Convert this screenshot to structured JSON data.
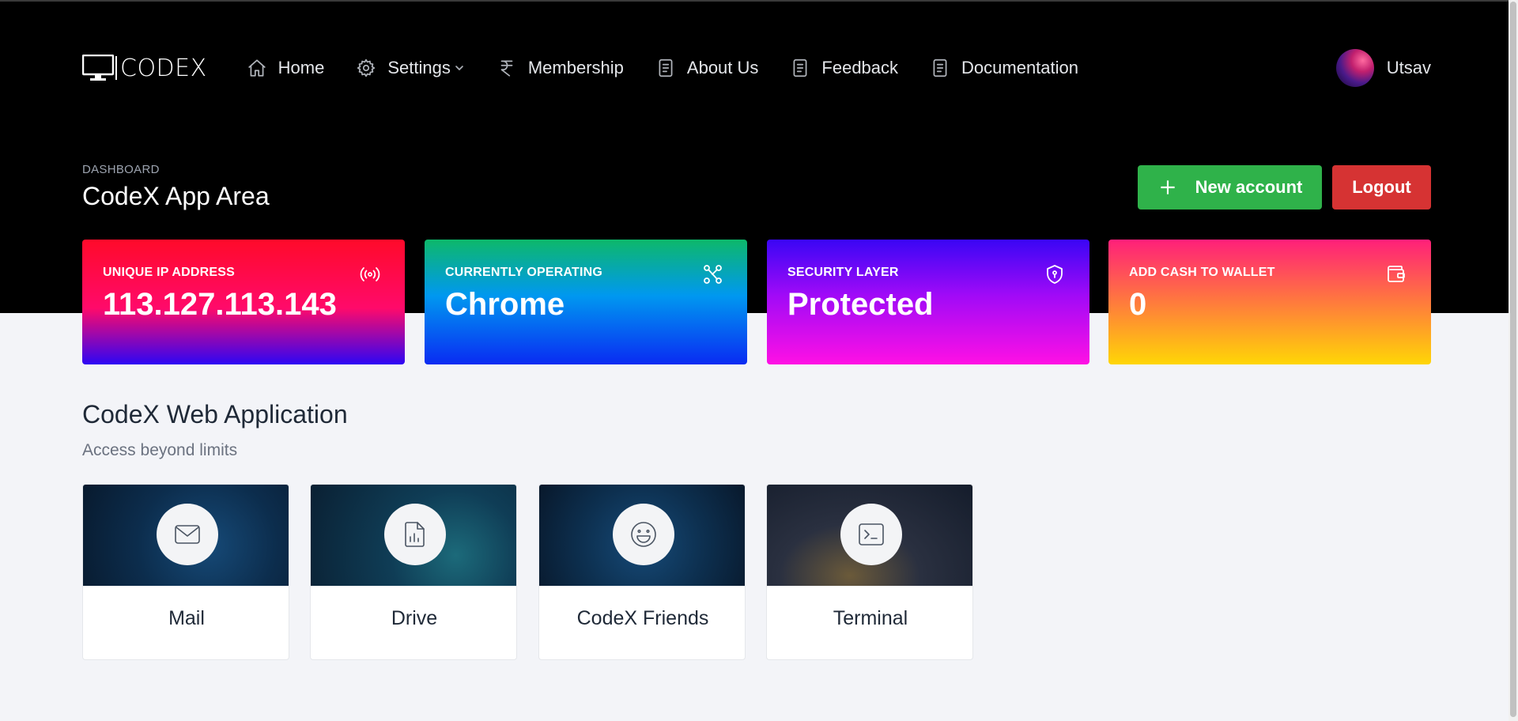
{
  "brand": {
    "name": "CODEX"
  },
  "nav": {
    "items": [
      {
        "label": "Home",
        "icon": "home-icon"
      },
      {
        "label": "Settings",
        "icon": "gear-icon"
      },
      {
        "label": "Membership",
        "icon": "rupee-icon"
      },
      {
        "label": "About Us",
        "icon": "document-icon"
      },
      {
        "label": "Feedback",
        "icon": "document-icon"
      },
      {
        "label": "Documentation",
        "icon": "document-icon"
      }
    ]
  },
  "user": {
    "name": "Utsav"
  },
  "page": {
    "breadcrumb": "DASHBOARD",
    "title": "CodeX App Area",
    "new_account_label": "New account",
    "logout_label": "Logout"
  },
  "stats": [
    {
      "label": "UNIQUE IP ADDRESS",
      "value": "113.127.113.143",
      "icon": "broadcast-icon"
    },
    {
      "label": "CURRENTLY OPERATING",
      "value": "Chrome",
      "icon": "network-icon"
    },
    {
      "label": "SECURITY LAYER",
      "value": "Protected",
      "icon": "shield-icon"
    },
    {
      "label": "ADD CASH TO WALLET",
      "value": "0",
      "icon": "wallet-icon"
    }
  ],
  "section": {
    "title": "CodeX Web Application",
    "subtitle": "Access beyond limits"
  },
  "apps": [
    {
      "name": "Mail",
      "icon": "mail-icon"
    },
    {
      "name": "Drive",
      "icon": "file-chart-icon"
    },
    {
      "name": "CodeX Friends",
      "icon": "smile-icon"
    },
    {
      "name": "Terminal",
      "icon": "terminal-icon"
    }
  ],
  "colors": {
    "new_account": "#2fb24a",
    "logout": "#d63333",
    "hero_bg": "#000000",
    "page_bg": "#f3f4f8"
  }
}
